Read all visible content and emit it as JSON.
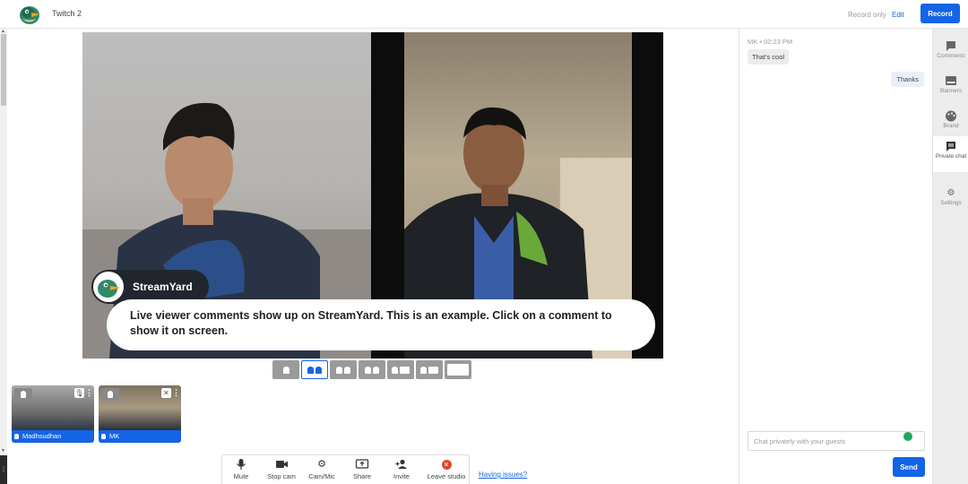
{
  "header": {
    "broadcast_title": "Twitch 2",
    "record_only": "Record only",
    "edit": "Edit",
    "record": "Record"
  },
  "stage": {
    "banner_name": "StreamYard",
    "comment_text": "Live viewer comments show up on StreamYard. This is an example. Click on a comment to show it on screen."
  },
  "participants": [
    {
      "name": "Madhsudhan",
      "mic": "on"
    },
    {
      "name": "MK",
      "mic": "muted"
    }
  ],
  "toolbar": {
    "mute": "Mute",
    "stop_cam": "Stop cam",
    "cam_mic": "Cam/Mic",
    "share": "Share",
    "invite": "Invite",
    "leave": "Leave studio",
    "having_issues": "Having issues?"
  },
  "chat": {
    "sender": "MK",
    "time": "02:23 PM",
    "message": "That's cool",
    "reply": "Thanks",
    "input_placeholder": "Chat privately with your guests",
    "send": "Send"
  },
  "rail": {
    "comments": "Comments",
    "banners": "Banners",
    "brand": "Brand",
    "private_chat": "Private chat",
    "settings": "Settings"
  },
  "colors": {
    "accent": "#1464e6",
    "leave": "#e0462e",
    "banner_bg": "#21262e"
  },
  "icons": [
    "streamyard-logo",
    "microphone-icon",
    "camera-icon",
    "gear-icon",
    "screen-share-icon",
    "invite-icon",
    "leave-icon",
    "comment-icon",
    "banner-icon",
    "palette-icon",
    "chat-icon",
    "settings-icon"
  ]
}
